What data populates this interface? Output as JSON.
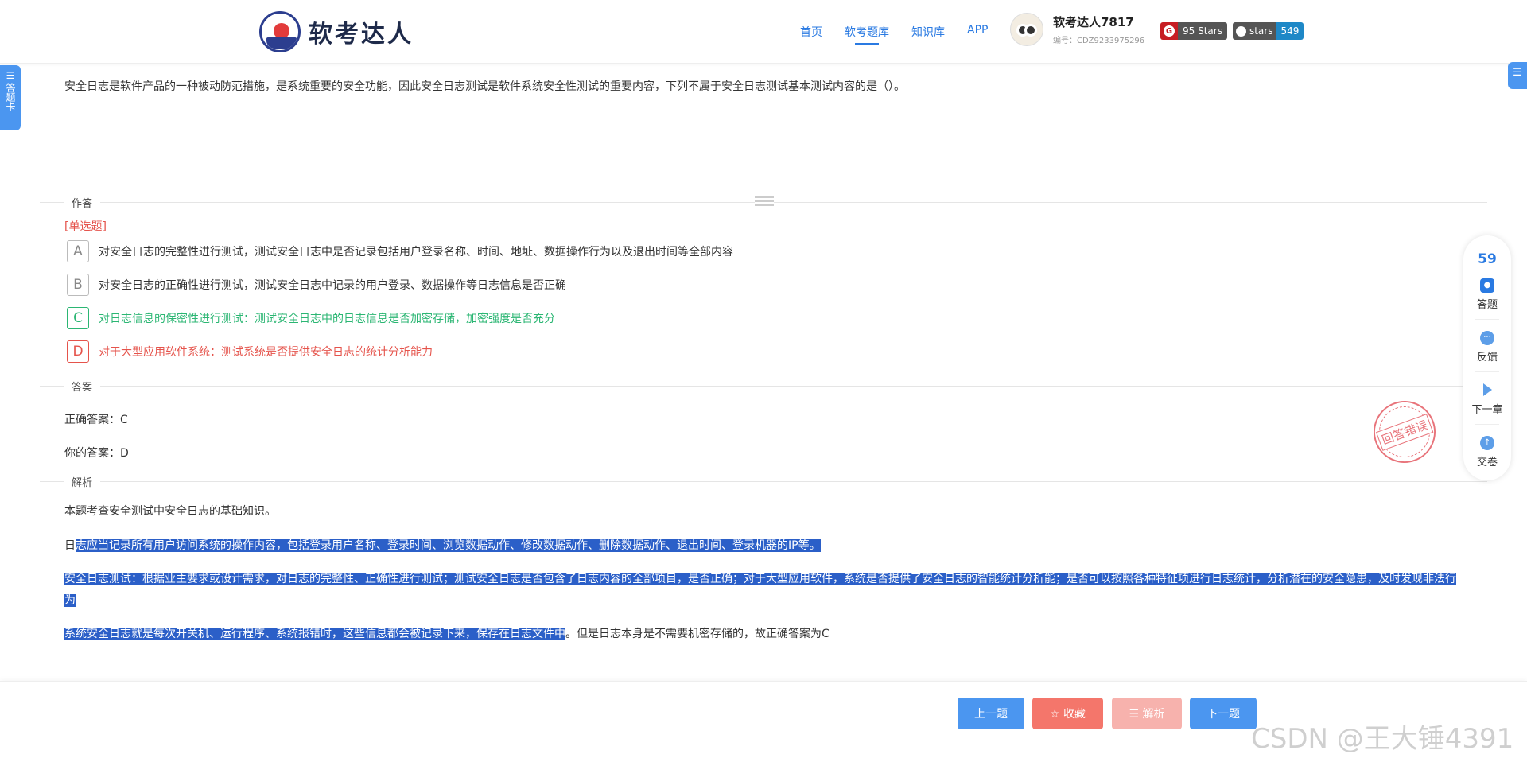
{
  "brand": {
    "name": "软考达人"
  },
  "nav": {
    "items": [
      "首页",
      "软考题库",
      "知识库",
      "APP"
    ],
    "active_index": 1
  },
  "user": {
    "name": "软考达人7817",
    "id": "编号：CDZ9233975296"
  },
  "badges": {
    "gitee_label": "95 Stars",
    "github_label": "stars",
    "github_count": "549"
  },
  "answer_card_tab": "答题卡",
  "question": {
    "text": "安全日志是软件产品的一种被动防范措施，是系统重要的安全功能，因此安全日志测试是软件系统安全性测试的重要内容，下列不属于安全日志测试基本测试内容的是（）。"
  },
  "sections": {
    "answering": "作答",
    "answer": "答案",
    "analysis": "解析"
  },
  "question_type": "[单选题]",
  "options": [
    {
      "key": "A",
      "text": "对安全日志的完整性进行测试，测试安全日志中是否记录包括用户登录名称、时间、地址、数据操作行为以及退出时间等全部内容",
      "state": "normal"
    },
    {
      "key": "B",
      "text": "对安全日志的正确性进行测试，测试安全日志中记录的用户登录、数据操作等日志信息是否正确",
      "state": "normal"
    },
    {
      "key": "C",
      "text": "对日志信息的保密性进行测试：测试安全日志中的日志信息是否加密存储，加密强度是否充分",
      "state": "correct"
    },
    {
      "key": "D",
      "text": "对于大型应用软件系统：测试系统是否提供安全日志的统计分析能力",
      "state": "wrong"
    }
  ],
  "answer": {
    "correct": "正确答案：C",
    "yours": "你的答案：D"
  },
  "stamp": "回答错误",
  "analysis": {
    "p1": "本题考查安全测试中安全日志的基础知识。",
    "p2_plain": "日",
    "p2_hl": "志应当记录所有用户访问系统的操作内容，包括登录用户名称、登录时间、浏览数据动作、修改数据动作、删除数据动作、退出时间、登录机器的IP等。",
    "p3_hl": "安全日志测试：根据业主要求或设计需求，对日志的完整性、正确性进行测试；测试安全日志是否包含了日志内容的全部项目，是否正确；对于大型应用软件，系统是否提供了安全日志的智能统计分析能；是否可以按照各种特征项进行日志统计，分析潜在的安全隐患，及时发现非法行为",
    "p4_hl": "系统安全日志就是每次开关机、运行程序、系统报错时，这些信息都会被记录下来，保存在日志文件中",
    "p4_plain": "。但是日志本身是不需要机密存储的，故正确答案为C"
  },
  "float_bar": {
    "number": "59",
    "items": [
      {
        "label": "答题",
        "icon": "answer-icon"
      },
      {
        "label": "反馈",
        "icon": "feedback-icon"
      },
      {
        "label": "下一章",
        "icon": "next-chapter-icon"
      },
      {
        "label": "交卷",
        "icon": "submit-icon"
      }
    ]
  },
  "footer": {
    "prev": "上一题",
    "favorite": "☆ 收藏",
    "analysis": "☰ 解析",
    "next": "下一题"
  },
  "watermark": "CSDN @王大锤4391"
}
